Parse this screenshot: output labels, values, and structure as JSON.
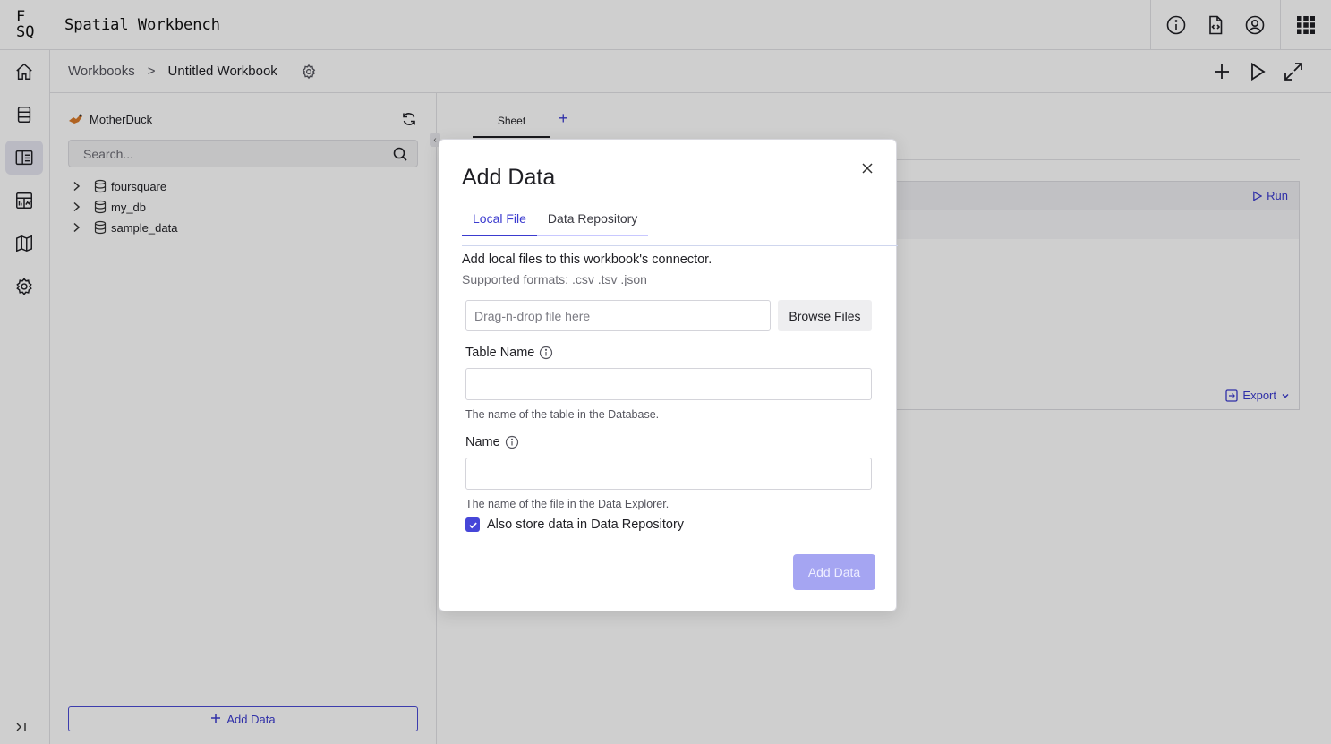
{
  "app": {
    "logo_line1": "F",
    "logo_line2": "SQ",
    "title": "Spatial Workbench"
  },
  "topbar": {
    "icons": [
      "info-icon",
      "file-code-icon",
      "user-icon",
      "apps-grid-icon"
    ]
  },
  "breadcrumb": {
    "root": "Workbooks",
    "separator": ">",
    "current": "Untitled Workbook"
  },
  "sidebar": {
    "connector_name": "MotherDuck",
    "search_placeholder": "Search...",
    "databases": [
      {
        "label": "foursquare"
      },
      {
        "label": "my_db"
      },
      {
        "label": "sample_data"
      }
    ],
    "add_data_label": "Add Data"
  },
  "main": {
    "sheet_tab": "Sheet",
    "run_label": "Run",
    "export_label": "Export"
  },
  "modal": {
    "title": "Add Data",
    "tabs": [
      {
        "label": "Local File",
        "active": true
      },
      {
        "label": "Data Repository",
        "active": false
      }
    ],
    "description": "Add local files to this workbook's connector.",
    "formats": "Supported formats: .csv .tsv .json",
    "dropzone_placeholder": "Drag-n-drop file here",
    "browse_label": "Browse Files",
    "table_name_label": "Table Name",
    "table_name_value": "",
    "table_name_hint": "The name of the table in the Database.",
    "name_label": "Name",
    "name_value": "",
    "name_hint": "The name of the file in the Data Explorer.",
    "store_checkbox_label": "Also store data in Data Repository",
    "store_checkbox_checked": true,
    "submit_label": "Add Data"
  },
  "colors": {
    "accent": "#3b3bcf",
    "submit_disabled": "#a5a5f2",
    "checkbox": "#4646d8"
  }
}
